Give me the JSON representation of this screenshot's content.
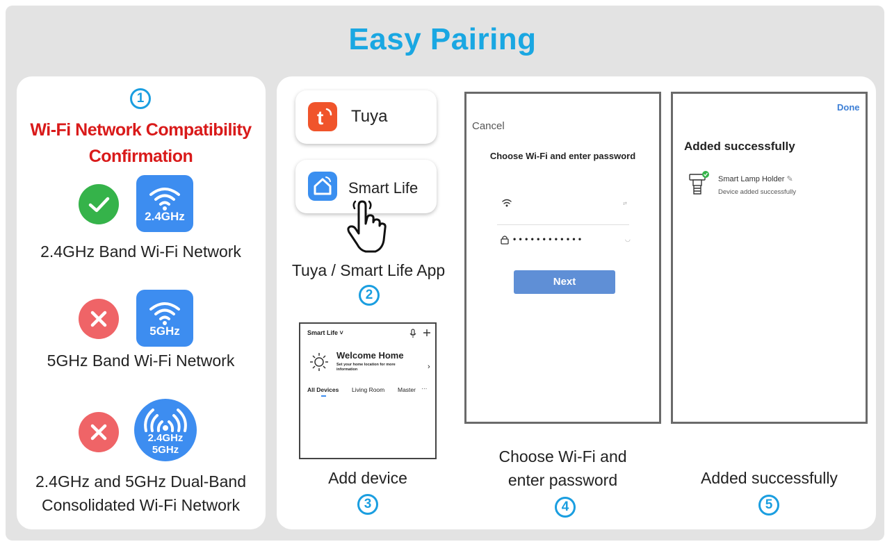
{
  "title": "Easy Pairing",
  "compatibility": {
    "step": "1",
    "title_line1": "Wi-Fi Network Compatibility",
    "title_line2": "Confirmation",
    "bands": [
      {
        "status": "supported",
        "badge": "2.4GHz",
        "label_line1": "2.4GHz Band Wi-Fi Network",
        "label_line2": ""
      },
      {
        "status": "unsupported",
        "badge": "5GHz",
        "label_line1": "5GHz Band Wi-Fi Network",
        "label_line2": ""
      },
      {
        "status": "unsupported",
        "badge_line1": "2.4GHz",
        "badge_line2": "5GHz",
        "label_line1": "2.4GHz and 5GHz Dual-Band",
        "label_line2": "Consolidated Wi-Fi Network"
      }
    ]
  },
  "apps": {
    "step": "2",
    "items": [
      {
        "name": "Tuya",
        "icon": "tuya-icon"
      },
      {
        "name": "Smart Life",
        "icon": "smart-life-icon"
      }
    ],
    "caption": "Tuya / Smart Life App"
  },
  "add_device": {
    "step": "3",
    "caption": "Add device",
    "header_app": "Smart Life",
    "welcome": "Welcome Home",
    "welcome_sub_line1": "Set your home location for more",
    "welcome_sub_line2": "information",
    "tabs": [
      "All Devices",
      "Living Room",
      "Master",
      "···"
    ]
  },
  "wifi_screen": {
    "step": "4",
    "cancel": "Cancel",
    "heading": "Choose Wi-Fi and enter password",
    "password_mask": "• • • • • • • • • • • •",
    "next_button": "Next",
    "caption_line1": "Choose Wi-Fi and",
    "caption_line2": "enter password"
  },
  "success_screen": {
    "step": "5",
    "done": "Done",
    "heading": "Added successfully",
    "device_name": "Smart Lamp Holder",
    "device_status": "Device added successfully",
    "caption": "Added successfully"
  },
  "colors": {
    "accent": "#1aa7e2",
    "warning_red": "#d91a1a",
    "ok_green": "#35b34a",
    "error_red": "#ef6467",
    "badge_blue": "#3d8df0"
  }
}
